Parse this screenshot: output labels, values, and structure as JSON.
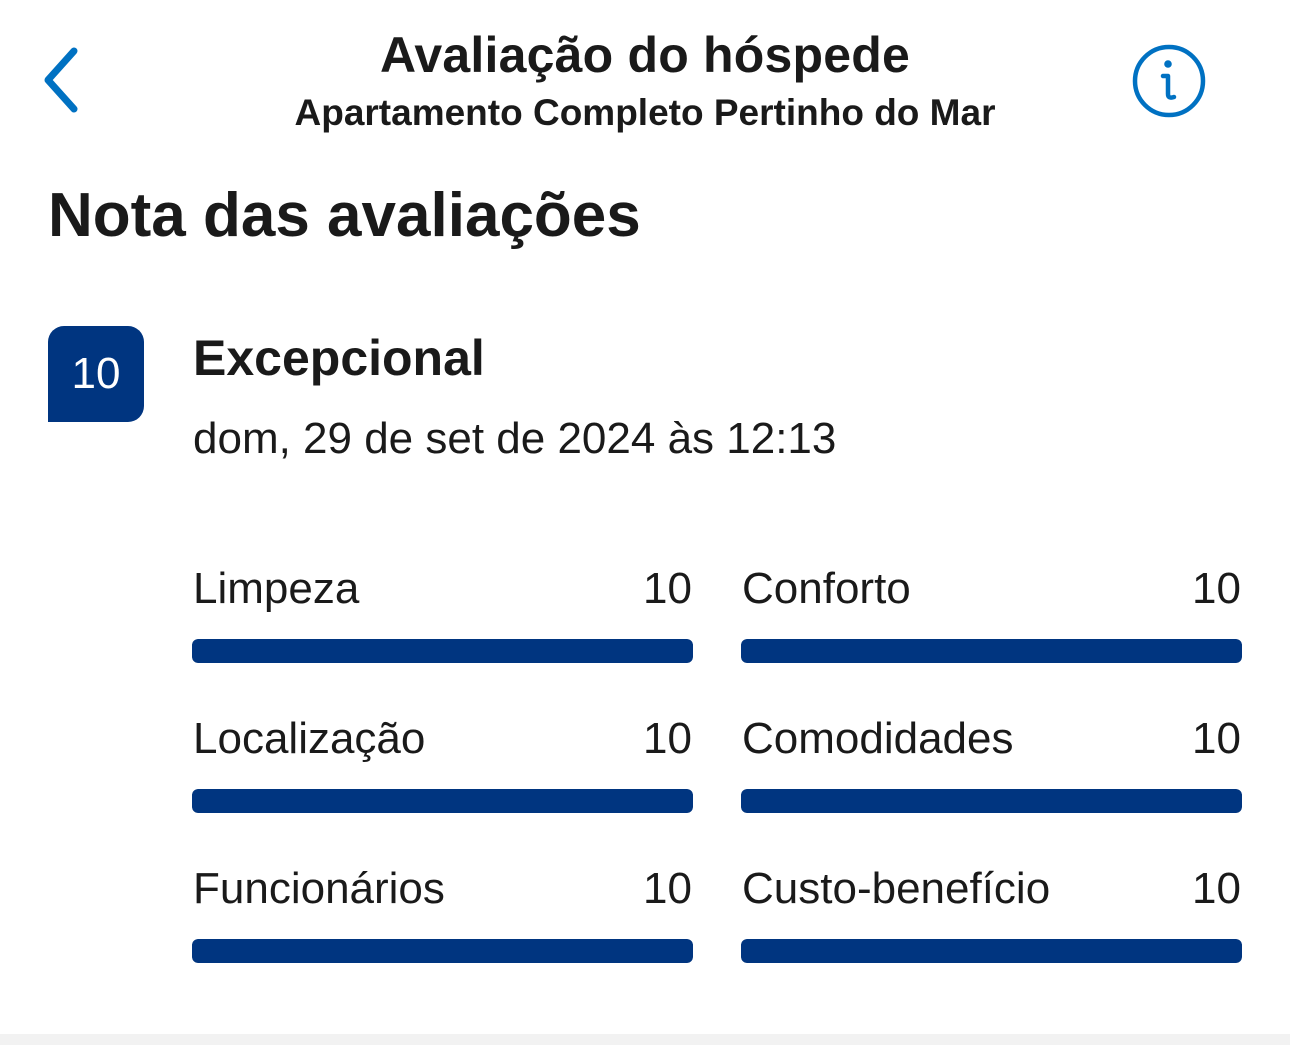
{
  "header": {
    "back_icon": "chevron-left-icon",
    "title": "Avaliação do hóspede",
    "subtitle": "Apartamento Completo Pertinho do Mar",
    "info_icon": "info-icon"
  },
  "section": {
    "title": "Nota das avaliações"
  },
  "review": {
    "score": "10",
    "rating_word": "Excepcional",
    "date": "dom, 29 de set de 2024 às 12:13"
  },
  "categories": [
    {
      "label": "Limpeza",
      "score": "10",
      "value": 10,
      "max": 10
    },
    {
      "label": "Conforto",
      "score": "10",
      "value": 10,
      "max": 10
    },
    {
      "label": "Localização",
      "score": "10",
      "value": 10,
      "max": 10
    },
    {
      "label": "Comodidades",
      "score": "10",
      "value": 10,
      "max": 10
    },
    {
      "label": "Funcionários",
      "score": "10",
      "value": 10,
      "max": 10
    },
    {
      "label": "Custo-benefício",
      "score": "10",
      "value": 10,
      "max": 10
    }
  ],
  "colors": {
    "accent_blue": "#0071c2",
    "brand_dark_blue": "#003580",
    "text": "#1a1a1a"
  }
}
